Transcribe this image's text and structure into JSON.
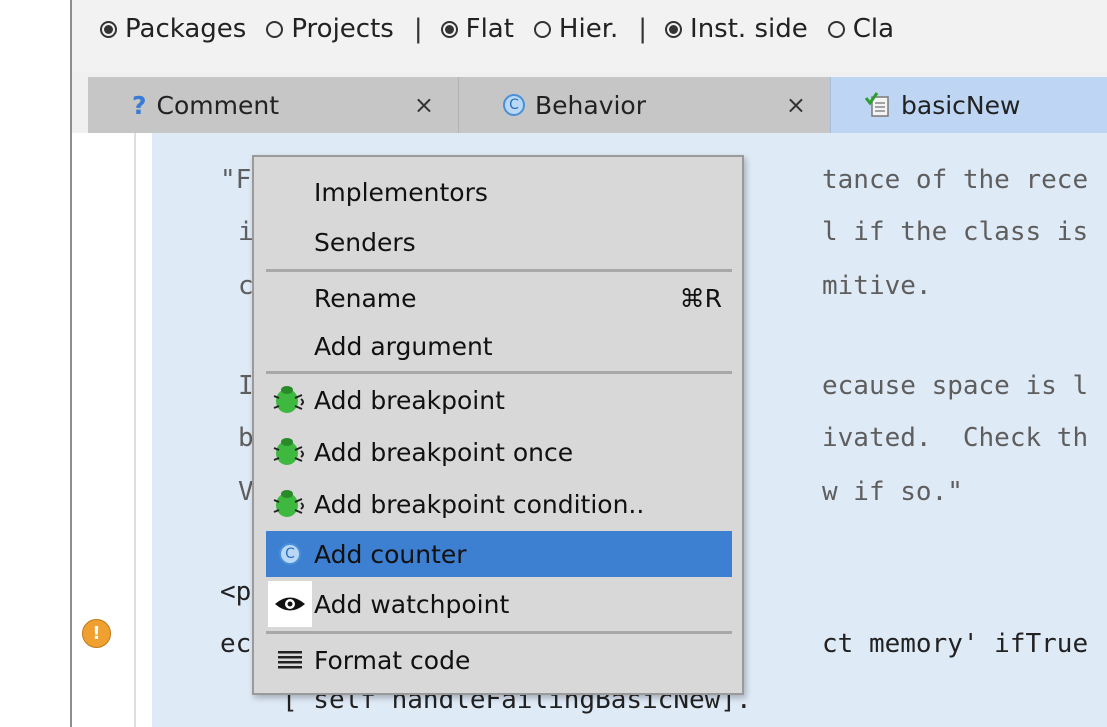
{
  "toolbar": {
    "radios": [
      {
        "label": "Packages",
        "selected": true
      },
      {
        "label": "Projects",
        "selected": false
      },
      {
        "label": "Flat",
        "selected": true
      },
      {
        "label": "Hier.",
        "selected": false
      },
      {
        "label": "Inst. side",
        "selected": true
      },
      {
        "label": "Cla",
        "selected": false
      }
    ],
    "separator": "|"
  },
  "tabs": [
    {
      "label": "Comment",
      "icon": "question-mark-icon",
      "close": "×"
    },
    {
      "label": "Behavior",
      "icon": "class-c-icon",
      "close": "×"
    },
    {
      "label": "basicNew",
      "icon": "method-checked-icon"
    }
  ],
  "code_lines": [
    "\"F",
    "i",
    "c",
    "I",
    "b",
    "V",
    "<p",
    "ec",
    "[ self handleFailingBasicNew]."
  ],
  "code_right": [
    "tance of the rece",
    "l if the class is",
    "mitive.",
    "ecause space is l",
    "ivated.  Check th",
    "w if so.\"",
    "ct memory' ifTrue"
  ],
  "code_mid_bottom": "asicNew].",
  "warning_glyph": "!",
  "class_badge_letter": "C",
  "menu": {
    "items": [
      {
        "label": "Implementors"
      },
      {
        "label": "Senders"
      },
      {
        "label": "Rename",
        "shortcut": "⌘R"
      },
      {
        "label": "Add argument"
      },
      {
        "label": "Add breakpoint",
        "icon": "bug-icon"
      },
      {
        "label": "Add breakpoint once",
        "icon": "bug-icon"
      },
      {
        "label": "Add breakpoint condition..",
        "icon": "bug-icon"
      },
      {
        "label": "Add counter",
        "icon": "counter-icon",
        "highlighted": true
      },
      {
        "label": "Add watchpoint",
        "icon": "eye-icon"
      },
      {
        "label": "Format code",
        "icon": "format-lines-icon"
      }
    ]
  },
  "colors": {
    "highlight": "#3d7fd1",
    "code_bg": "#dfeaf7",
    "active_tab": "#bed6f3",
    "warning": "#f0a030"
  }
}
